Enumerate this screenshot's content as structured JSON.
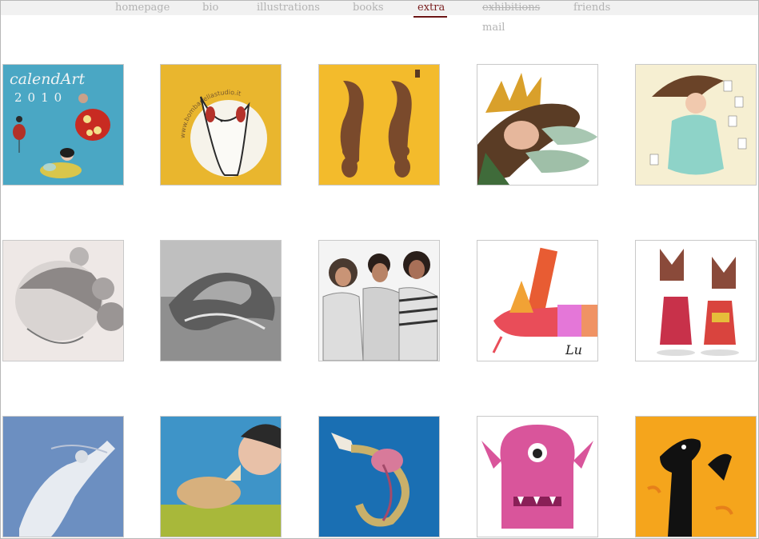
{
  "nav": {
    "items": [
      {
        "label": "homepage"
      },
      {
        "label": "bio"
      },
      {
        "label": "illustrations"
      },
      {
        "label": "books"
      },
      {
        "label": "extra"
      },
      {
        "label": "exhibitions"
      },
      {
        "label": "friends"
      },
      {
        "label": "mail"
      }
    ]
  },
  "gallery": {
    "tile1": {
      "title_text": "calendArt",
      "year_text": "2010"
    },
    "tile2": {
      "ring_text": "www.bombanellastudio.it"
    },
    "tile14": {
      "signature": "Lu"
    }
  },
  "colors": {
    "accent": "#6b1515",
    "nav_text": "#b3b3b3",
    "topbar": "#f1f1f1"
  }
}
